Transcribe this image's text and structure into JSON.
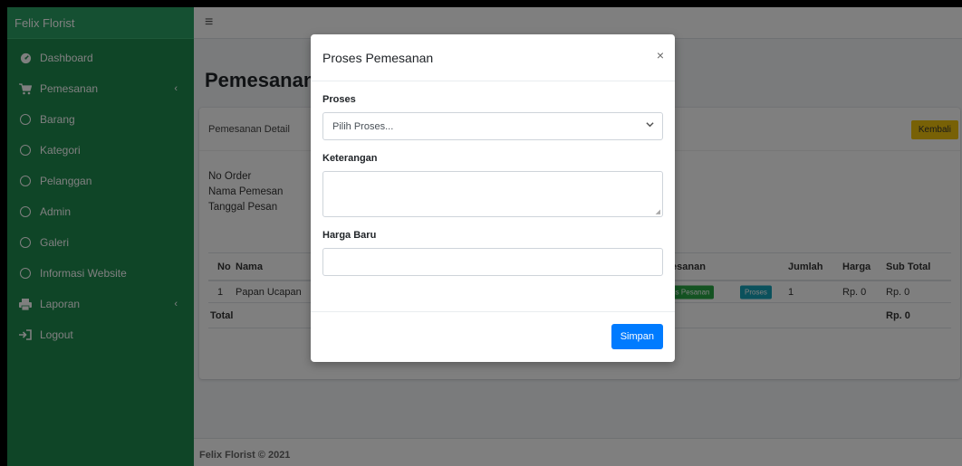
{
  "brand": "Felix Florist",
  "sidebar": {
    "items": [
      {
        "label": "Dashboard",
        "icon": "tachometer-icon"
      },
      {
        "label": "Pemesanan",
        "icon": "cart-icon",
        "chevron": "‹"
      },
      {
        "label": "Barang",
        "icon": "circle-icon"
      },
      {
        "label": "Kategori",
        "icon": "circle-icon"
      },
      {
        "label": "Pelanggan",
        "icon": "circle-icon"
      },
      {
        "label": "Admin",
        "icon": "circle-icon"
      },
      {
        "label": "Galeri",
        "icon": "circle-icon"
      },
      {
        "label": "Informasi Website",
        "icon": "circle-icon"
      },
      {
        "label": "Laporan",
        "icon": "print-icon",
        "chevron": "‹"
      },
      {
        "label": "Logout",
        "icon": "logout-icon"
      }
    ]
  },
  "topbar": {
    "menu_glyph": "≡"
  },
  "page": {
    "title": "Pemesanan D"
  },
  "card": {
    "header": "Pemesanan Detail",
    "back_button": "Kembali",
    "info": {
      "order_no_label": "No Order",
      "customer_label": "Nama Pemesan",
      "date_label": "Tanggal Pesan"
    },
    "table": {
      "headers": {
        "no": "No",
        "name": "Nama",
        "status": "Status Pesanan",
        "qty": "Jumlah",
        "price": "Harga",
        "subtotal": "Sub Total"
      },
      "rows": [
        {
          "no": "1",
          "name": "Papan Ucapan",
          "status_badge": "Status Pesanan",
          "process_badge": "Proses",
          "qty": "1",
          "price": "Rp. 0",
          "subtotal": "Rp. 0"
        }
      ],
      "total_label": "Total",
      "total_value": "Rp. 0"
    }
  },
  "footer": "Felix Florist © 2021",
  "modal": {
    "title": "Proses Pemesanan",
    "close": "×",
    "process_label": "Proses",
    "process_placeholder": "Pilih Proses...",
    "note_label": "Keterangan",
    "new_price_label": "Harga Baru",
    "save_button": "Simpan"
  },
  "colors": {
    "sidebar": "#1e8a4f",
    "brand_bar": "#2aa165",
    "primary": "#007bff",
    "warning": "#f0c30c",
    "success_badge": "#28a745",
    "info_badge": "#17a2b8"
  }
}
